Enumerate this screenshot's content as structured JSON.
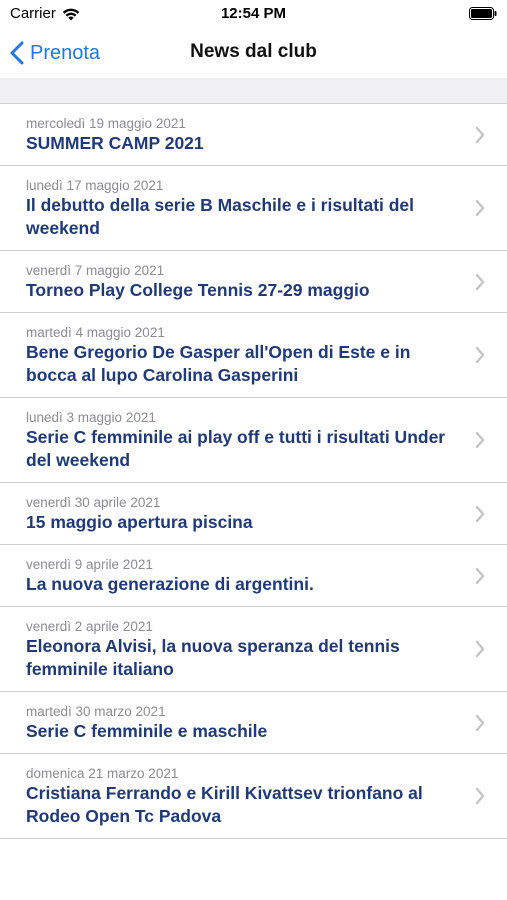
{
  "status_bar": {
    "carrier": "Carrier",
    "time": "12:54 PM"
  },
  "nav": {
    "back_label": "Prenota",
    "title": "News dal club"
  },
  "colors": {
    "accent": "#1f78e6",
    "title_text": "#1f3a7a",
    "date_text": "#8c8c91"
  },
  "news": [
    {
      "date": "mercoledì 19 maggio 2021",
      "title": "SUMMER CAMP 2021"
    },
    {
      "date": "lunedì 17 maggio 2021",
      "title": "Il debutto della serie B Maschile e i risultati del weekend"
    },
    {
      "date": "venerdì 7 maggio 2021",
      "title": "Torneo Play College Tennis 27-29 maggio"
    },
    {
      "date": "martedì 4 maggio 2021",
      "title": "Bene Gregorio De Gasper all'Open di Este e in bocca al lupo Carolina Gasperini"
    },
    {
      "date": "lunedì 3 maggio 2021",
      "title": "Serie C femminile ai play off e tutti i risultati Under del weekend"
    },
    {
      "date": "venerdì 30 aprile 2021",
      "title": "15 maggio apertura piscina"
    },
    {
      "date": "venerdì 9 aprile 2021",
      "title": "La nuova generazione di argentini."
    },
    {
      "date": "venerdì 2 aprile 2021",
      "title": "Eleonora Alvisi, la nuova speranza del tennis femminile italiano"
    },
    {
      "date": "martedì 30 marzo 2021",
      "title": "Serie C femminile e maschile"
    },
    {
      "date": "domenica 21 marzo 2021",
      "title": "Cristiana Ferrando e Kirill Kivattsev trionfano al Rodeo Open Tc Padova"
    }
  ]
}
